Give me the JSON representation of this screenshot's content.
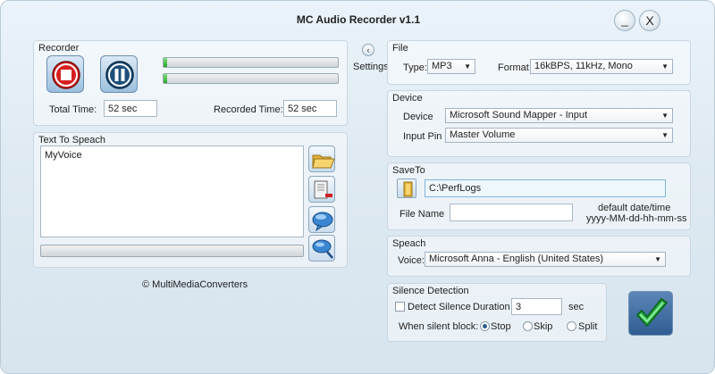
{
  "window": {
    "title": "MC Audio Recorder v1.1",
    "minimize_glyph": "_",
    "close_glyph": "X"
  },
  "recorder": {
    "title": "Recorder",
    "total_time_label": "Total Time:",
    "total_time_value": "52 sec",
    "recorded_time_label": "Recorded Time:",
    "recorded_time_value": "52 sec",
    "level_left": 0.02,
    "level_right": 0.02
  },
  "settings": {
    "label": "Settings",
    "glyph": "‹"
  },
  "tts": {
    "title": "Text To Speach",
    "text": "MyVoice",
    "progress": 0
  },
  "copyright": "© MultiMediaConverters",
  "file": {
    "title": "File",
    "type_label": "Type:",
    "type_value": "MP3",
    "format_label": "Format",
    "format_value": "16kBPS, 11kHz, Mono"
  },
  "device": {
    "title": "Device",
    "device_label": "Device",
    "device_value": "Microsoft Sound Mapper - Input",
    "input_pin_label": "Input Pin",
    "input_pin_value": "Master Volume"
  },
  "saveto": {
    "title": "SaveTo",
    "path": "C:\\PerfLogs",
    "file_name_label": "File Name",
    "file_name_value": "",
    "default_hint_1": "default date/time",
    "default_hint_2": "yyyy-MM-dd-hh-mm-ss"
  },
  "speach": {
    "title": "Speach",
    "voice_label": "Voice:",
    "voice_value": "Microsoft Anna - English (United States)"
  },
  "silence": {
    "title": "Silence Detection",
    "detect_label": "Detect Silence",
    "detect_checked": false,
    "duration_label": "Duration",
    "duration_value": "3",
    "duration_unit": "sec",
    "when_silent_label": "When silent block:",
    "options": [
      "Stop",
      "Skip",
      "Split"
    ],
    "selected": "Stop"
  },
  "colors": {
    "accent": "#2f5d93",
    "meter_green": "#2aa52a",
    "stop_red": "#d62020",
    "ok_green": "#2db34a"
  }
}
